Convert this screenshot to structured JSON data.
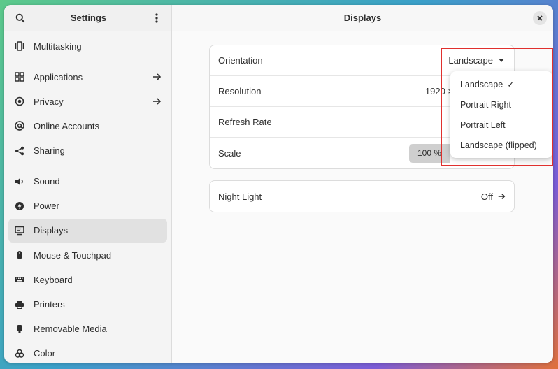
{
  "sidebar": {
    "title": "Settings",
    "items": [
      {
        "label": "Multitasking",
        "icon": "multitasking-icon",
        "arrow": false
      },
      {
        "label": "Applications",
        "icon": "applications-icon",
        "arrow": true
      },
      {
        "label": "Privacy",
        "icon": "privacy-icon",
        "arrow": true
      },
      {
        "label": "Online Accounts",
        "icon": "online-accounts-icon",
        "arrow": false
      },
      {
        "label": "Sharing",
        "icon": "sharing-icon",
        "arrow": false
      },
      {
        "label": "Sound",
        "icon": "sound-icon",
        "arrow": false
      },
      {
        "label": "Power",
        "icon": "power-icon",
        "arrow": false
      },
      {
        "label": "Displays",
        "icon": "displays-icon",
        "arrow": false,
        "active": true
      },
      {
        "label": "Mouse & Touchpad",
        "icon": "mouse-icon",
        "arrow": false
      },
      {
        "label": "Keyboard",
        "icon": "keyboard-icon",
        "arrow": false
      },
      {
        "label": "Printers",
        "icon": "printer-icon",
        "arrow": false
      },
      {
        "label": "Removable Media",
        "icon": "removable-media-icon",
        "arrow": false
      },
      {
        "label": "Color",
        "icon": "color-icon",
        "arrow": false
      }
    ]
  },
  "main": {
    "title": "Displays",
    "display_card": {
      "orientation_label": "Orientation",
      "orientation_value": "Landscape",
      "resolution_label": "Resolution",
      "resolution_value": "1920 ×",
      "refresh_label": "Refresh Rate",
      "scale_label": "Scale",
      "scale_value": "100 %"
    },
    "night_light": {
      "label": "Night Light",
      "value": "Off"
    }
  },
  "orientation_popover": {
    "options": [
      "Landscape",
      "Portrait Right",
      "Portrait Left",
      "Landscape (flipped)"
    ],
    "selected": "Landscape",
    "check_mark": "✓"
  },
  "colors": {
    "highlight": "#e0302e",
    "active_item": "#e1e1e1"
  }
}
